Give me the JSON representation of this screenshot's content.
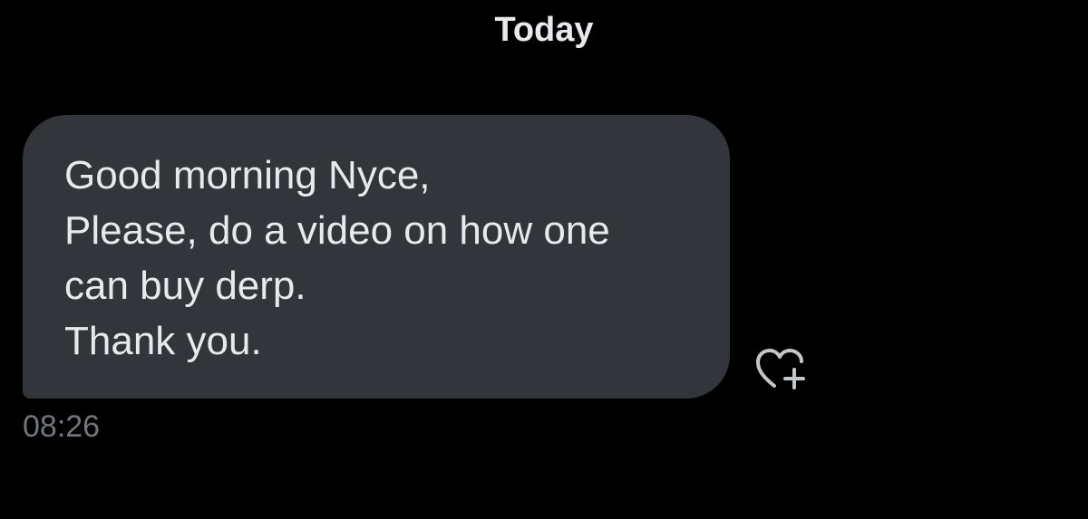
{
  "conversation": {
    "date_separator": "Today",
    "messages": [
      {
        "lines": [
          "Good morning Nyce,",
          "Please, do a video on how one",
          "can buy derp.",
          "Thank you."
        ],
        "timestamp": "08:26",
        "reaction_icon": "heart-plus-icon"
      }
    ]
  },
  "colors": {
    "background": "#000000",
    "bubble": "#323539",
    "text_primary": "#e7e9ea",
    "text_secondary": "#71767b"
  }
}
